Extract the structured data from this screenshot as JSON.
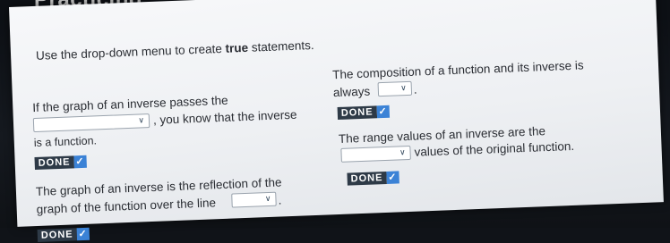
{
  "heading": "Practicing",
  "instructions": {
    "text_before": "Use the drop-down menu to create ",
    "bold": "true",
    "text_after": " statements."
  },
  "questions": [
    {
      "line1": "If the graph of an inverse passes the",
      "line2_after": ", you know that the inverse",
      "line3": "is a function.",
      "done_label": "DONE"
    },
    {
      "line1": "The graph of an inverse is the reflection of the",
      "line2_before": "graph of the function over the line",
      "line2_after": ".",
      "done_label": "DONE"
    },
    {
      "line1": "The composition of a function and its inverse is",
      "line2_before": "always",
      "line2_after": ".",
      "done_label": "DONE"
    },
    {
      "line1": "The range values of an inverse are the",
      "line2_after": "values of the original function.",
      "done_label": "DONE"
    }
  ],
  "dropdowns": [
    {
      "selected": ""
    },
    {
      "selected": ""
    },
    {
      "selected": ""
    },
    {
      "selected": ""
    }
  ],
  "icons": {
    "chevron": "chevron-down-icon",
    "check": "checkmark-icon"
  },
  "colors": {
    "done_bg": "#2e3a47",
    "check_bg": "#3b82d6"
  }
}
